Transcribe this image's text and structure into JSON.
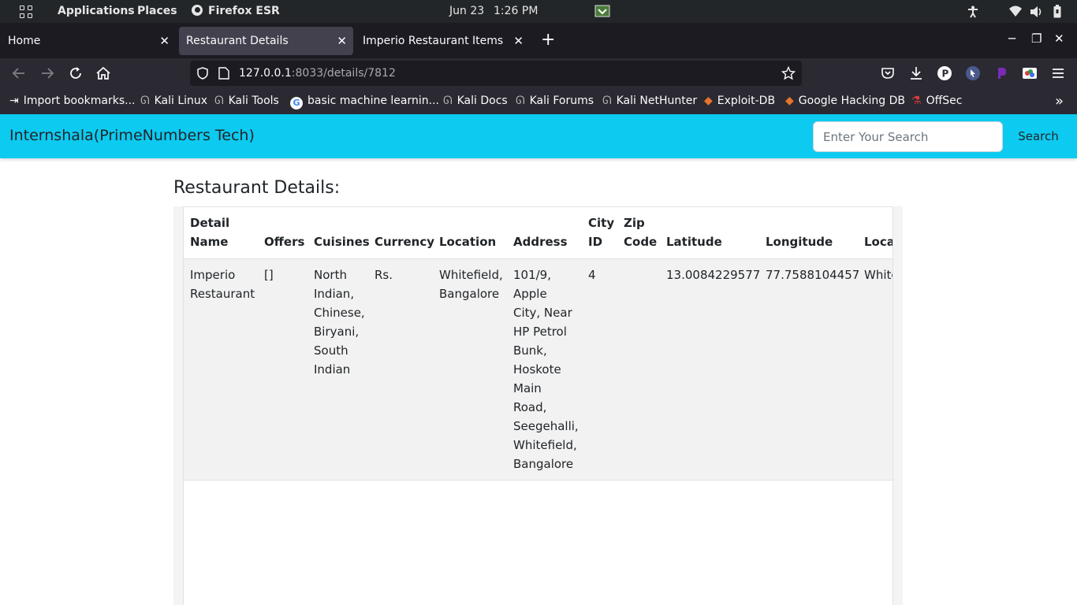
{
  "system": {
    "applications": "Applications",
    "places": "Places",
    "browser": "Firefox ESR",
    "date": "Jun 23",
    "time": "1:26 PM"
  },
  "tabs": [
    {
      "label": "Home"
    },
    {
      "label": "Restaurant Details"
    },
    {
      "label": "Imperio Restaurant Items"
    }
  ],
  "url": {
    "host": "127.0.0.1",
    "path": ":8033/details/7812"
  },
  "bookmarks": [
    "Import bookmarks...",
    "Kali Linux",
    "Kali Tools",
    "basic machine learnin...",
    "Kali Docs",
    "Kali Forums",
    "Kali NetHunter",
    "Exploit-DB",
    "Google Hacking DB",
    "OffSec"
  ],
  "site": {
    "brand": "Internshala(PrimeNumbers Tech)",
    "search_placeholder": "Enter Your Search",
    "search_button": "Search"
  },
  "page": {
    "heading": "Restaurant Details:",
    "columns": [
      "Detail Name",
      "Offers",
      "Cuisines",
      "Currency",
      "Location",
      "Address",
      "City ID",
      "Zip Code",
      "Latitude",
      "Longitude",
      "Local"
    ],
    "row": {
      "name": "Imperio Restaurant",
      "offers": "[]",
      "cuisines": "North Indian, Chinese, Biryani, South Indian",
      "currency": "Rs.",
      "location": "Whitefield, Bangalore",
      "address": "101/9, Apple City, Near HP Petrol Bunk, Hoskote Main Road, Seegehalli, Whitefield, Bangalore",
      "city_id": "4",
      "zip_code": "",
      "latitude": "13.0084229577",
      "longitude": "77.7588104457",
      "locality": "Whitefield"
    }
  },
  "colors": {
    "navbar": "#0dcaf0",
    "browser_chrome": "#2b2a33",
    "tabstrip": "#1c1b22"
  }
}
